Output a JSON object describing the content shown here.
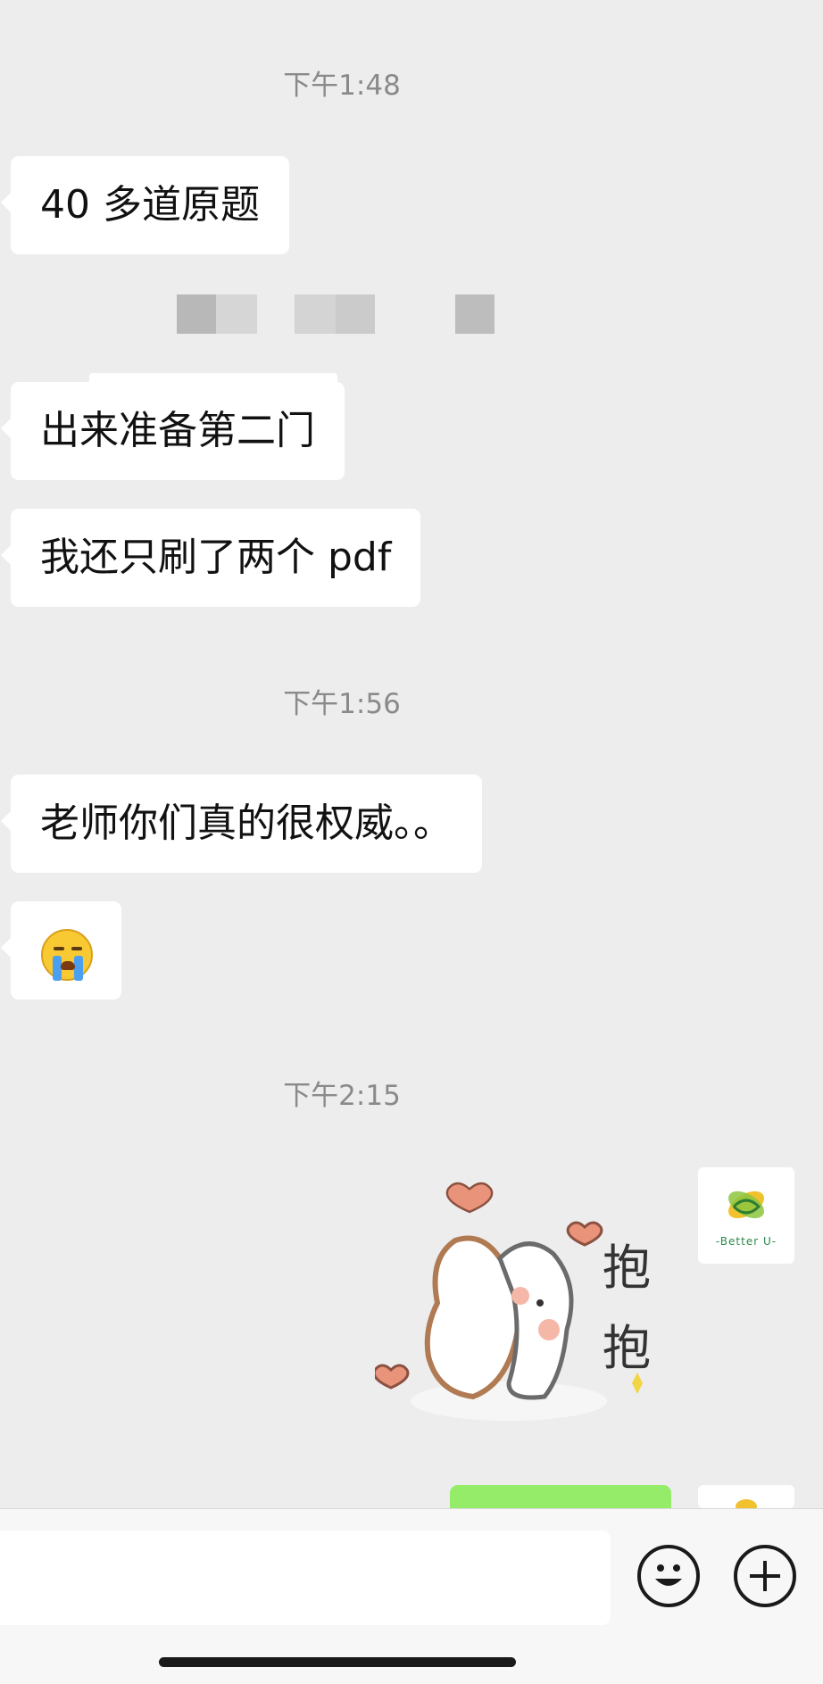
{
  "messages": {
    "ts1": "下午1:48",
    "m1": "40 多道原题",
    "m2": "出来准备第二门",
    "m3": "我还只刷了两个 pdf",
    "ts2": "下午1:56",
    "m4": "老师你们真的很权威。。",
    "ts3": "下午2:15",
    "sticker_text": "抱抱"
  },
  "avatar": {
    "brand": "-Better U-"
  },
  "icons": {
    "emoji": "emoji-button-icon",
    "plus": "plus-button-icon"
  },
  "colors": {
    "background": "#ededed",
    "bubble_incoming": "#ffffff",
    "bubble_outgoing": "#95ec69",
    "timestamp": "#8a8a8a"
  }
}
